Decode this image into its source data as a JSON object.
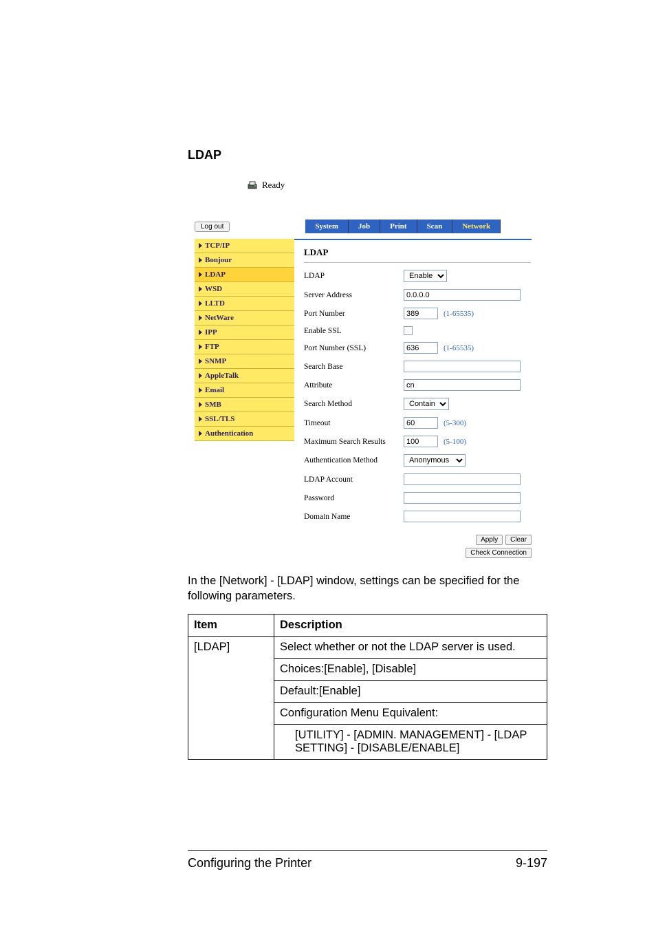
{
  "section_title": "LDAP",
  "status": {
    "label": "Ready"
  },
  "logout_label": "Log out",
  "tabs": [
    "System",
    "Job",
    "Print",
    "Scan",
    "Network"
  ],
  "sidebar": {
    "items": [
      {
        "label": "TCP/IP"
      },
      {
        "label": "Bonjour"
      },
      {
        "label": "LDAP",
        "active": true
      },
      {
        "label": "WSD"
      },
      {
        "label": "LLTD"
      },
      {
        "label": "NetWare"
      },
      {
        "label": "IPP"
      },
      {
        "label": "FTP"
      },
      {
        "label": "SNMP"
      },
      {
        "label": "AppleTalk"
      },
      {
        "label": "Email"
      },
      {
        "label": "SMB"
      },
      {
        "label": "SSL/TLS"
      },
      {
        "label": "Authentication"
      }
    ]
  },
  "panel": {
    "title": "LDAP",
    "rows": {
      "ldap_label": "LDAP",
      "ldap_value": "Enable",
      "server_address_label": "Server Address",
      "server_address_value": "0.0.0.0",
      "port_label": "Port Number",
      "port_value": "389",
      "port_hint": "(1-65535)",
      "enable_ssl_label": "Enable SSL",
      "port_ssl_label": "Port Number (SSL)",
      "port_ssl_value": "636",
      "port_ssl_hint": "(1-65535)",
      "search_base_label": "Search Base",
      "search_base_value": "",
      "attribute_label": "Attribute",
      "attribute_value": "cn",
      "search_method_label": "Search Method",
      "search_method_value": "Contain",
      "timeout_label": "Timeout",
      "timeout_value": "60",
      "timeout_hint": "(5-300)",
      "max_results_label": "Maximum Search Results",
      "max_results_value": "100",
      "max_results_hint": "(5-100)",
      "auth_method_label": "Authentication Method",
      "auth_method_value": "Anonymous",
      "ldap_account_label": "LDAP Account",
      "ldap_account_value": "",
      "password_label": "Password",
      "password_value": "",
      "domain_label": "Domain Name",
      "domain_value": ""
    },
    "buttons": {
      "apply": "Apply",
      "clear": "Clear",
      "check_connection": "Check Connection"
    }
  },
  "description": "In the [Network] - [LDAP] window, settings can be specified for the following parameters.",
  "doc_table": {
    "header": [
      "Item",
      "Description"
    ],
    "item": "[LDAP]",
    "lines": [
      "Select whether or not the LDAP server is used.",
      "Choices:[Enable], [Disable]",
      "Default:[Enable]",
      "Configuration Menu Equivalent:",
      "[UTILITY] - [ADMIN. MANAGEMENT] - [LDAP SETTING] - [DISABLE/ENABLE]"
    ]
  },
  "footer": {
    "left": "Configuring the Printer",
    "right": "9-197"
  }
}
